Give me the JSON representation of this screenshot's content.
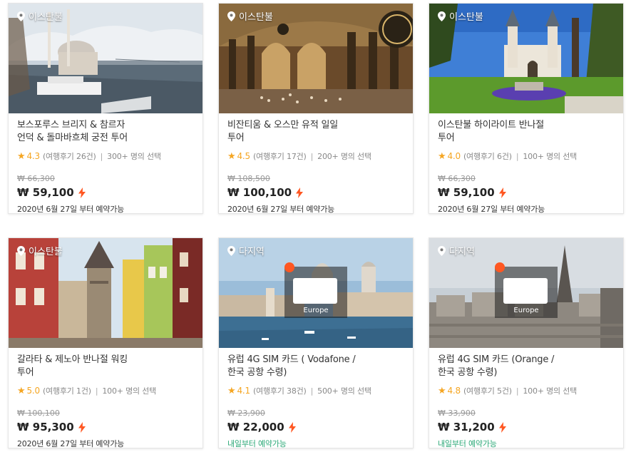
{
  "cards": [
    {
      "location": "이스탄불",
      "title": "보스포루스 브리지 & 참르자\n언덕 & 돌마바흐체 궁전 투어",
      "rating": "4.3",
      "reviews": "(여행후기 26건)",
      "chosen": "300+ 명의 선택",
      "old_price": "₩ 66,300",
      "price": "₩ 59,100",
      "availability": "2020년 6월 27일 부터 예약가능",
      "image": "bosphorus-mosque-photo"
    },
    {
      "location": "이스탄불",
      "title": "비잔티움 & 오스만 유적 일일\n투어",
      "rating": "4.5",
      "reviews": "(여행후기 17건)",
      "chosen": "200+ 명의 선택",
      "old_price": "₩ 108,500",
      "price": "₩ 100,100",
      "availability": "2020년 6월 27일 부터 예약가능",
      "image": "hagia-sophia-interior-photo"
    },
    {
      "location": "이스탄불",
      "title": "이스탄불 하이라이트 반나절\n투어",
      "rating": "4.0",
      "reviews": "(여행후기 6건)",
      "chosen": "100+ 명의 선택",
      "old_price": "₩ 66,300",
      "price": "₩ 59,100",
      "availability": "2020년 6월 27일 부터 예약가능",
      "image": "topkapi-gate-photo"
    },
    {
      "location": "이스탄불",
      "title": "갈라타 & 제노아 반나절 워킹\n투어",
      "rating": "5.0",
      "reviews": "(여행후기 1건)",
      "chosen": "100+ 명의 선택",
      "old_price": "₩ 100,100",
      "price": "₩ 95,300",
      "availability": "2020년 6월 27일 부터 예약가능",
      "image": "galata-tower-photo"
    },
    {
      "location": "다지역",
      "title": "유럽 4G SIM 카드 ( Vodafone /\n한국 공항 수령)",
      "rating": "4.1",
      "reviews": "(여행후기 38건)",
      "chosen": "500+ 명의 선택",
      "old_price": "₩ 23,900",
      "price": "₩ 22,000",
      "availability": "내일부터 예약가능",
      "image": "venice-sim-photo",
      "sim_label": "Europe"
    },
    {
      "location": "다지역",
      "title": "유럽 4G SIM 카드 (Orange /\n한국 공항 수령)",
      "rating": "4.8",
      "reviews": "(여행후기 5건)",
      "chosen": "100+ 명의 선택",
      "old_price": "₩ 33,900",
      "price": "₩ 31,200",
      "availability": "내일부터 예약가능",
      "image": "paris-sim-photo",
      "sim_label": "Europe"
    }
  ],
  "colors": {
    "star": "#f5a623",
    "bolt": "#ff5722",
    "available_green": "#2aa876"
  }
}
